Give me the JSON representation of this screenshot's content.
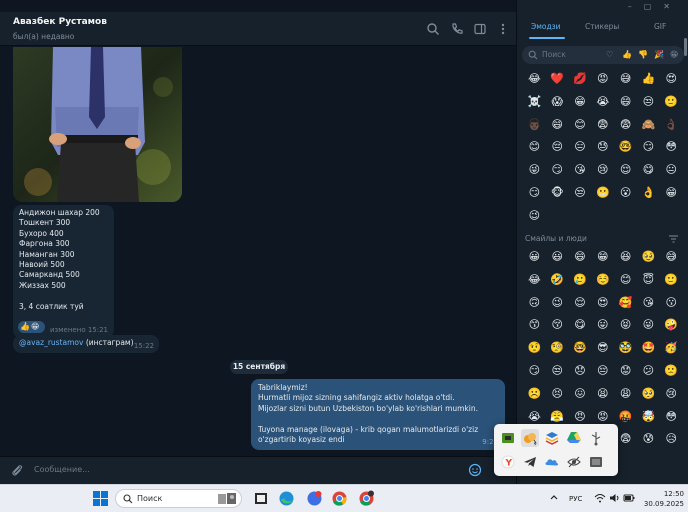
{
  "window": {
    "controls": [
      "–",
      "▢",
      "✕"
    ]
  },
  "chat": {
    "contact_name": "Авазбек Рустамов",
    "contact_status": "был(а) недавно",
    "price_message": {
      "lines": [
        "Андижон шахар 200",
        "Тошкент 300",
        "Бухоро 400",
        "Фаргона 300",
        "Наманган 300",
        "Навоий 500",
        "Самарканд 500",
        "Жиззах 500",
        "",
        "3, 4 соатлик туй"
      ],
      "reactions": [
        "👍",
        "😁"
      ],
      "edited": "изменено 15:21"
    },
    "instagram_message": {
      "link": "@avaz_rustamov",
      "text": "(инстаграм)",
      "time": "15:22"
    },
    "date_separator": "15 сентября",
    "outgoing_message": {
      "lines": [
        "Tabriklaymiz!",
        "Hurmatli mijoz sizning sahifangiz aktiv holatga o'tdi.",
        "Mijozlar sizni butun Uzbekiston bo'ylab ko'rishlari mumkin.",
        "",
        "Tuyona manage (ilovaga) - krib qogan malumotlarizdi o'ziz",
        "o'zgartirib koyasiz endi"
      ],
      "time": "9:25"
    },
    "composer_placeholder": "Сообщение..."
  },
  "emoji_panel": {
    "tabs": [
      "Эмодзи",
      "Стикеры",
      "GIF"
    ],
    "active_tab": "Эмодзи",
    "search_placeholder": "Поиск",
    "search_category_icons": [
      "♡",
      "👍",
      "👎",
      "🎉",
      "😁"
    ],
    "recent": [
      "😂",
      "❤️",
      "💋",
      "😡",
      "😅",
      "👍",
      "😍",
      "☠️",
      "😱",
      "😁",
      "😭",
      "😄",
      "😒",
      "🙂",
      "👨🏿",
      "😄",
      "😊",
      "😨",
      "😨",
      "🙈",
      "👌🏿",
      "😊",
      "😔",
      "😑",
      "😓",
      "🤓",
      "😏",
      "😳",
      "😜",
      "😏",
      "😘",
      "😢",
      "😌",
      "😋",
      "😐",
      "😏",
      "🐵",
      "😒",
      "😬",
      "😮",
      "👌",
      "😁",
      "😉"
    ],
    "section_label": "Смайлы и люди",
    "smileys": [
      "😀",
      "😃",
      "😄",
      "😁",
      "😆",
      "🥹",
      "😅",
      "😂",
      "🤣",
      "🥲",
      "☺️",
      "😊",
      "😇",
      "🙂",
      "🙃",
      "😉",
      "😌",
      "😍",
      "🥰",
      "😘",
      "😗",
      "😙",
      "😚",
      "😋",
      "😛",
      "😝",
      "😜",
      "🤪",
      "🤨",
      "🧐",
      "🤓",
      "😎",
      "🥸",
      "🤩",
      "🥳",
      "😏",
      "😒",
      "😞",
      "😔",
      "😟",
      "😕",
      "🙁",
      "☹️",
      "😣",
      "😖",
      "😫",
      "😩",
      "🥺",
      "😢",
      "😭",
      "😤",
      "😠",
      "😡",
      "🤬",
      "🤯",
      "😳",
      "🥵",
      "🥶",
      "😶‍🌫️",
      "😱",
      "😨",
      "😰",
      "😥"
    ]
  },
  "taskbar": {
    "search_label": "Поиск",
    "language": "РУС",
    "time": "12:50",
    "date": "30.09.2025"
  },
  "colors": {
    "chat_bg": "#0e1621",
    "header_bg": "#17212b",
    "incoming_bubble": "#182533",
    "outgoing_bubble": "#2b5278",
    "accent": "#5eb5f7",
    "link": "#6ab3f3"
  }
}
